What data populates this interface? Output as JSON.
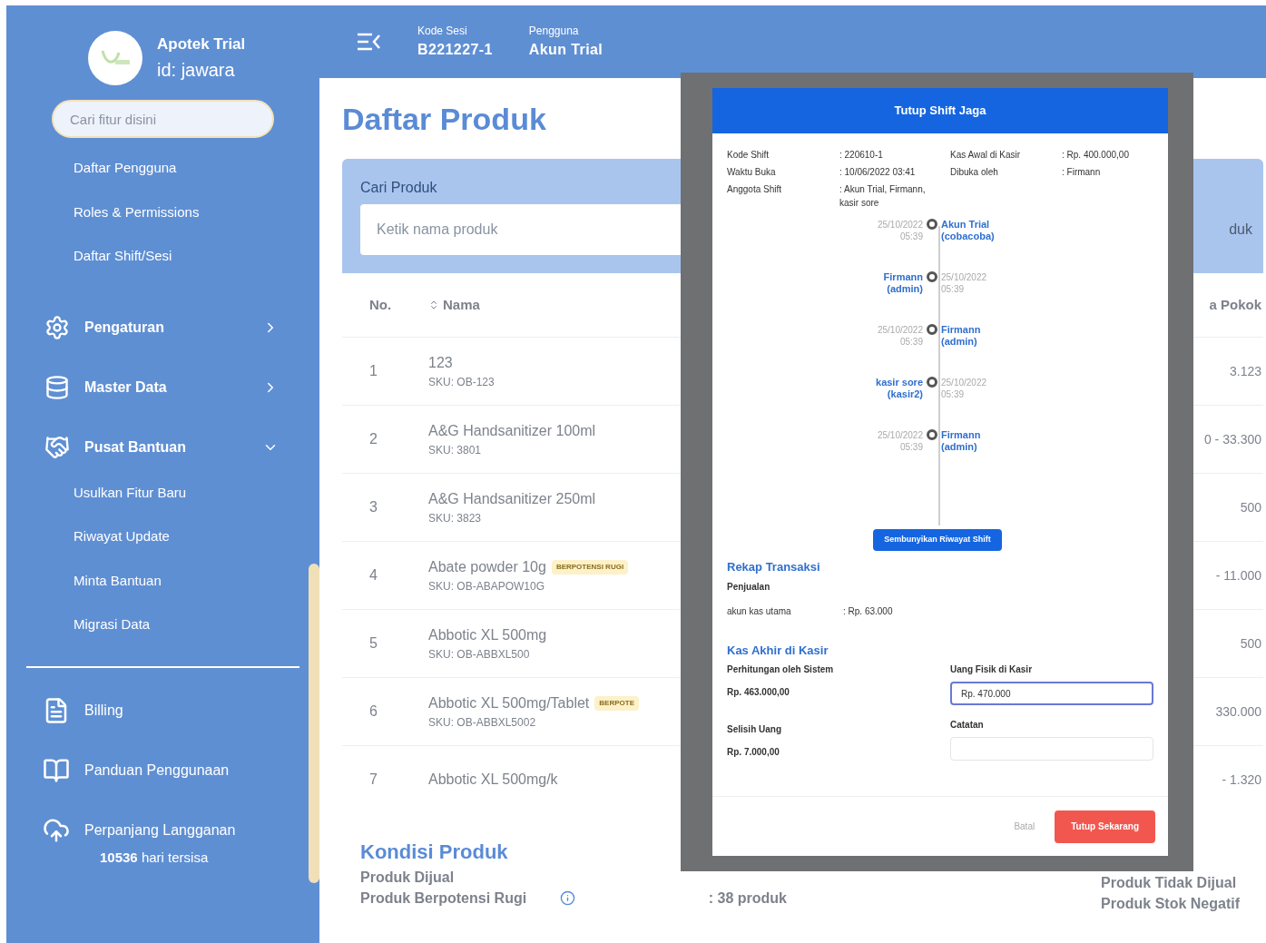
{
  "sidebar": {
    "brand": {
      "name": "Apotek Trial",
      "id": "id: jawara"
    },
    "search": {
      "placeholder": "Cari fitur disini"
    },
    "top_items": [
      "Daftar Pengguna",
      "Roles & Permissions",
      "Daftar Shift/Sesi"
    ],
    "groups": [
      {
        "label": "Pengaturan",
        "expanded": false
      },
      {
        "label": "Master Data",
        "expanded": false
      },
      {
        "label": "Pusat Bantuan",
        "expanded": true,
        "children": [
          "Usulkan Fitur Baru",
          "Riwayat Update",
          "Minta Bantuan",
          "Migrasi Data"
        ]
      }
    ],
    "bottom_items": [
      "Billing",
      "Panduan Penggunaan",
      "Perpanjang Langganan"
    ],
    "remaining": "**10536** hari tersisa"
  },
  "header": {
    "session": {
      "label": "Kode Sesi",
      "value": "B221227-1"
    },
    "user": {
      "label": "Pengguna",
      "value": "Akun Trial"
    }
  },
  "page": {
    "title": "Daftar Produk",
    "search": {
      "label": "Cari Produk",
      "placeholder": "Ketik nama produk"
    },
    "column_2": "duk",
    "table": {
      "columns": [
        "No.",
        "Nama",
        "a Pokok"
      ],
      "rows": [
        {
          "no": "1",
          "name": "123",
          "sku": "SKU: OB-123",
          "column_3": "3.123"
        },
        {
          "no": "2",
          "name": "A&G Handsanitizer 100ml",
          "sku": "SKU: 3801",
          "column_3": "0 - 33.300"
        },
        {
          "no": "3",
          "name": "A&G Handsanitizer 250ml",
          "sku": "SKU: 3823",
          "column_3": "500"
        },
        {
          "no": "4",
          "name": "Abate powder 10g",
          "sku": "SKU: OB-ABAPOW10G",
          "badge": "BERPOTENSI RUGI",
          "column_3": "- 11.000"
        },
        {
          "no": "5",
          "name": "Abbotic XL 500mg",
          "sku": "SKU: OB-ABBXL500",
          "column_3": "500"
        },
        {
          "no": "6",
          "name": "Abbotic XL 500mg/Tablet",
          "sku": "SKU: OB-ABBXL5002",
          "badge": "BERPOTE",
          "column_3": "330.000"
        },
        {
          "no": "7",
          "name": "Abbotic XL 500mg/k",
          "column_3": "- 1.320"
        }
      ]
    },
    "condition": {
      "title": "Kondisi Produk",
      "rows": [
        {
          "label": "Produk Dijual",
          "info": false
        },
        {
          "label": "Produk Berpotensi Rugi",
          "value": ": 38 produk",
          "info": true
        }
      ],
      "right_labels": [
        "Produk Tidak Dijual",
        "Produk Stok Negatif"
      ]
    }
  },
  "modal": {
    "title": "Tutup Shift Jaga",
    "info_left": [
      {
        "label": "Kode Shift",
        "value": ": 220610-1"
      },
      {
        "label": "Waktu Buka",
        "value": ": 10/06/2022 03:41"
      },
      {
        "label": "Anggota Shift",
        "value": ": Akun Trial, Firmann, kasir sore"
      }
    ],
    "info_right": [
      {
        "label": "Kas Awal di Kasir",
        "value": ": Rp. 400.000,00"
      },
      {
        "label": "Dibuka oleh",
        "value": ": Firmann"
      }
    ],
    "timeline": [
      {
        "time": "25/10/2022 05:39",
        "name": "Akun Trial (cobacoba)",
        "kind": "nameright"
      },
      {
        "time": "25/10/2022 05:39",
        "name": "Firmann (admin)",
        "kind": "nameleft"
      },
      {
        "time": "25/10/2022 05:39",
        "name": "Firmann (admin)",
        "kind": "nameright"
      },
      {
        "time": "25/10/2022 05:39",
        "name": "kasir sore (kasir2)",
        "kind": "nameleft"
      },
      {
        "time": "25/10/2022 05:39",
        "name": "Firmann (admin)",
        "kind": "nameright"
      }
    ],
    "toggle_button": "Sembunyikan Riwayat Shift",
    "recap": {
      "title": "Rekap Transaksi",
      "subtitle": "Penjualan",
      "rows": [
        {
          "label": "akun kas utama",
          "value": ": Rp. 63.000"
        }
      ]
    },
    "closing": {
      "title": "Kas Akhir di Kasir",
      "system_label": "Perhitungan oleh Sistem",
      "system_value": "Rp. 463.000,00",
      "diff_label": "Selisih Uang",
      "diff_value": "Rp. 7.000,00",
      "cash_field": {
        "label": "Uang Fisik di Kasir",
        "value": "Rp. 470.000",
        "focused": true
      },
      "note_field": {
        "label": "Catatan"
      }
    },
    "buttons": {
      "cancel": "Batal",
      "confirm": "Tutup Sekarang"
    }
  }
}
